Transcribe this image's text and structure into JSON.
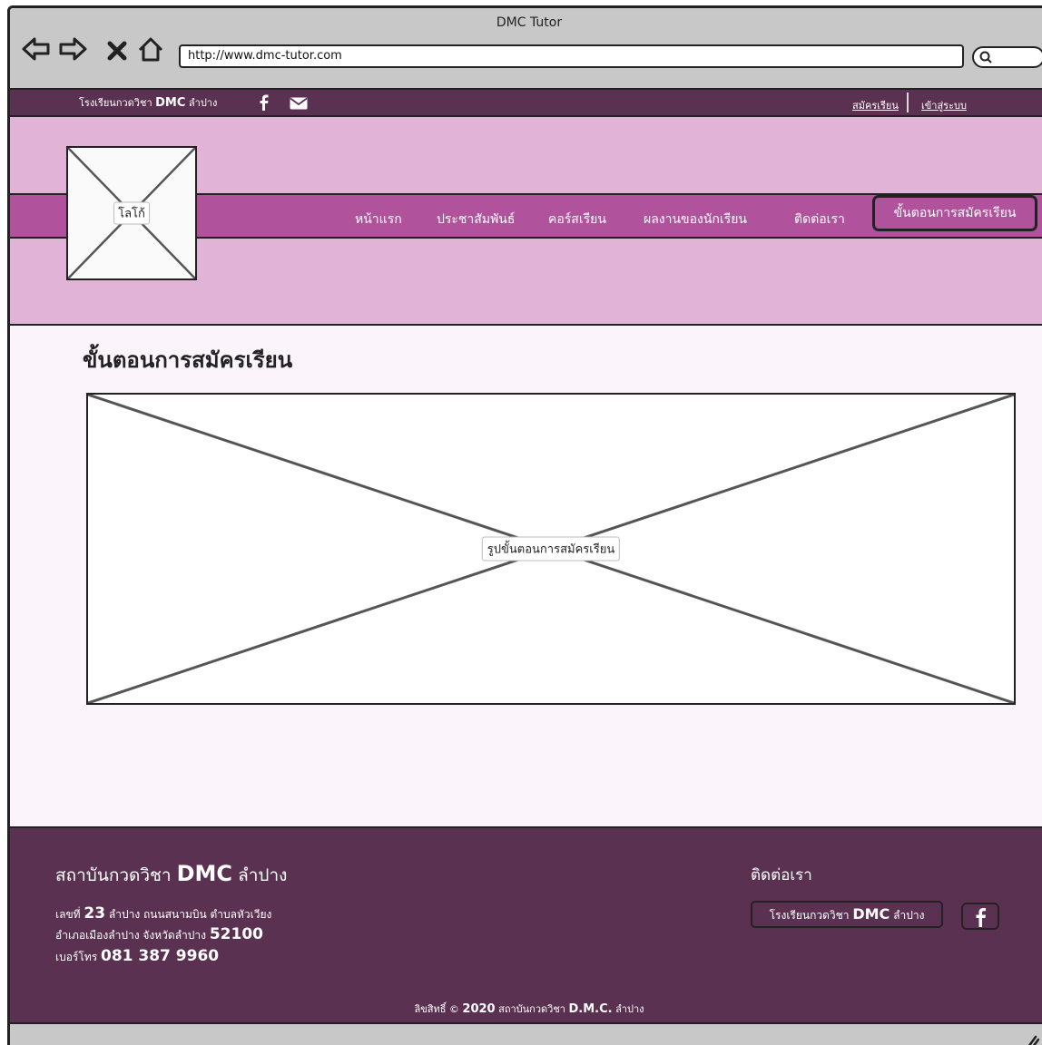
{
  "browser": {
    "window_title": "DMC Tutor",
    "url": "http://www.dmc-tutor.com",
    "icons": [
      "back-icon",
      "forward-icon",
      "close-icon",
      "home-icon",
      "search-icon"
    ]
  },
  "topbar": {
    "school_prefix": "โรงเรียนกวดวิชา",
    "school_brand": "DMC",
    "school_suffix": "ลำปาง",
    "register_link": "สมัครเรียน",
    "login_link": "เข้าสู่ระบบ"
  },
  "header": {
    "logo_label": "โลโก้",
    "menu": [
      "หน้าแรก",
      "ประชาสัมพันธ์",
      "คอร์สเรียน",
      "ผลงานของนักเรียน",
      "ติดต่อเรา"
    ],
    "active_menu": "ขั้นตอนการสมัครเรียน"
  },
  "main": {
    "title": "ขั้นตอนการสมัครเรียน",
    "image_label": "รูปขั้นตอนการสมัครเรียน"
  },
  "footer": {
    "org_prefix": "สถาบันกวดวิชา",
    "org_brand": "DMC",
    "org_suffix": "ลำปาง",
    "address_line1_prefix": "เลขที่",
    "address_line1_num": "23",
    "address_line1_rest": "ลำปาง ถนนสนามบิน ตำบลหัวเวียง",
    "address_line2_prefix": "อำเภอเมืองลำปาง จังหวัดลำปาง",
    "address_line2_num": "52100",
    "phone_prefix": "เบอร์โทร",
    "phone": "081 387 9960",
    "contact_title": "ติดต่อเรา",
    "fb_button_prefix": "โรงเรียนกวดวิชา",
    "fb_button_brand": "DMC",
    "fb_button_suffix": "ลำปาง",
    "copyright_prefix": "ลิขสิทธิ์ ©",
    "copyright_year": "2020",
    "copyright_org": "สถาบันกวดวิชา",
    "copyright_brand": "D.M.C.",
    "copyright_suffix": "ลำปาง"
  },
  "colors": {
    "topbar": "#5a3150",
    "header": "#e1b3d6",
    "navband": "#b0529c",
    "main_bg": "#fcf4fb",
    "footer": "#5a3150"
  }
}
